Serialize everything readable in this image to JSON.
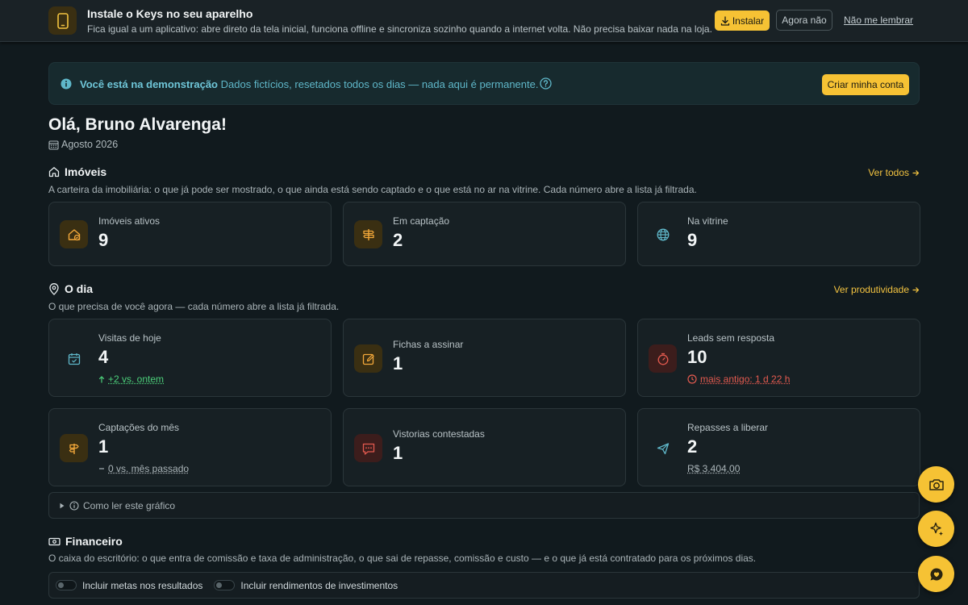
{
  "install_banner": {
    "title": "Instale o Keys no seu aparelho",
    "description": "Fica igual a um aplicativo: abre direto da tela inicial, funciona offline e sincroniza sozinho quando a internet volta. Não precisa baixar nada na loja.",
    "install_label": "Instalar",
    "later_label": "Agora não",
    "never_label": "Não me lembrar"
  },
  "demo_banner": {
    "bold": "Você está na demonstração",
    "text": "Dados fictícios, resetados todos os dias — nada aqui é permanente.",
    "button_label": "Criar minha conta"
  },
  "header": {
    "greeting": "Olá, Bruno Alvarenga!",
    "month": "Agosto 2026"
  },
  "imoveis": {
    "title": "Imóveis",
    "description": "A carteira da imobiliária: o que já pode ser mostrado, o que ainda está sendo captado e o que está no ar na vitrine. Cada número abre a lista já filtrada.",
    "link": "Ver todos",
    "cards": [
      {
        "label": "Imóveis ativos",
        "value": "9"
      },
      {
        "label": "Em captação",
        "value": "2"
      },
      {
        "label": "Na vitrine",
        "value": "9"
      }
    ]
  },
  "odia": {
    "title": "O dia",
    "description": "O que precisa de você agora — cada número abre a lista já filtrada.",
    "link": "Ver produtividade",
    "cards": [
      {
        "label": "Visitas de hoje",
        "value": "4",
        "sub": "+2 vs. ontem"
      },
      {
        "label": "Fichas a assinar",
        "value": "1"
      },
      {
        "label": "Leads sem resposta",
        "value": "10",
        "sub": "mais antigo: 1 d 22 h"
      },
      {
        "label": "Captações do mês",
        "value": "1",
        "sub": "0 vs. mês passado"
      },
      {
        "label": "Vistorias contestadas",
        "value": "1"
      },
      {
        "label": "Repasses a liberar",
        "value": "2",
        "sub": "R$ 3.404,00"
      }
    ],
    "chart_help": "Como ler este gráfico"
  },
  "financeiro": {
    "title": "Financeiro",
    "description": "O caixa do escritório: o que entra de comissão e taxa de administração, o que sai de repasse, comissão e custo — e o que já está contratado para os próximos dias.",
    "toggle_goals": "Incluir metas nos resultados",
    "toggle_investments": "Incluir rendimentos de investimentos"
  },
  "colors": {
    "accent": "#f6c234",
    "background": "#111a1e",
    "info": "#5fb7c9",
    "positive": "#4ccf7a",
    "negative": "#e35a4f"
  }
}
